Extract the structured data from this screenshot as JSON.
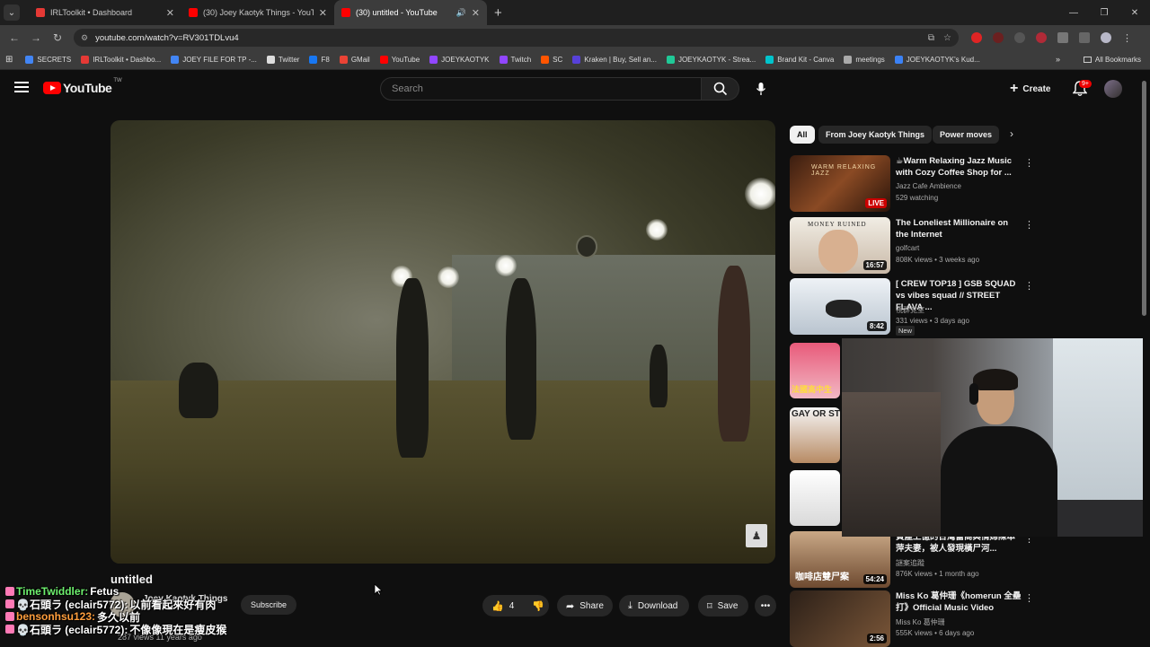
{
  "browser": {
    "tabs": [
      {
        "title": "IRLToolkit • Dashboard",
        "favicon_color": "#e53935"
      },
      {
        "title": "(30) Joey Kaotyk Things - YouTube",
        "favicon_color": "#ff0000"
      },
      {
        "title": "(30) untitled - YouTube",
        "favicon_color": "#ff0000"
      }
    ],
    "url": "youtube.com/watch?v=RV301TDLvu4",
    "bookmarks": [
      {
        "label": "SECRETS",
        "color": "#4285f4"
      },
      {
        "label": "IRLToolkit • Dashbo...",
        "color": "#e53935"
      },
      {
        "label": "JOEY FILE FOR TP -...",
        "color": "#4285f4"
      },
      {
        "label": "Twitter",
        "color": "#dddddd"
      },
      {
        "label": "F8",
        "color": "#1877f2"
      },
      {
        "label": "GMail",
        "color": "#ea4335"
      },
      {
        "label": "YouTube",
        "color": "#ff0000"
      },
      {
        "label": "JOEYKAOTYK",
        "color": "#9146ff"
      },
      {
        "label": "Twitch",
        "color": "#9146ff"
      },
      {
        "label": "SC",
        "color": "#ff5500"
      },
      {
        "label": "Kraken | Buy, Sell an...",
        "color": "#5741d9"
      },
      {
        "label": "JOEYKAOTYK - Strea...",
        "color": "#20c997"
      },
      {
        "label": "Brand Kit - Canva",
        "color": "#00c4cc"
      },
      {
        "label": "meetings",
        "color": "#aaaaaa"
      },
      {
        "label": "JOEYKAOTYK's Kud...",
        "color": "#3b82f6"
      }
    ],
    "all_bookmarks": "All Bookmarks"
  },
  "youtube": {
    "logo_text": "YouTube",
    "logo_region": "TW",
    "search_placeholder": "Search",
    "create_label": "Create",
    "notif_count": "9+"
  },
  "video": {
    "title": "untitled",
    "channel": "Joey Kaotyk Things",
    "subscribe_label": "Subscribe",
    "meta": "287 views  11 years ago",
    "likes": "4",
    "share_label": "Share",
    "download_label": "Download",
    "save_label": "Save"
  },
  "chips": [
    "All",
    "From Joey Kaotyk Things",
    "Power moves"
  ],
  "recommendations": [
    {
      "title": "☕Warm Relaxing Jazz Music with Cozy Coffee Shop for ...",
      "channel": "Jazz Cafe Ambience",
      "stats": "529 watching",
      "badge": "LIVE",
      "thumb_text": "WARM RELAXING JAZZ"
    },
    {
      "title": "The Loneliest Millionaire on the Internet",
      "channel": "golfcart",
      "stats": "808K views • 3 weeks ago",
      "badge": "16:57",
      "thumb_text": "MONEY RUINED"
    },
    {
      "title": "[ CREW TOP18 ] GSB SQUAD vs vibes squad // STREET FLAVA ...",
      "channel": "視群覚室",
      "stats": "331 views • 3 days ago",
      "badge": "8:42",
      "new_label": "New"
    },
    {
      "title": "資產上億的台灣富商與情婦陳萃萍夫妻，被人發現橫尸河...",
      "channel": "謎案追蹤",
      "stats": "876K views • 1 month ago",
      "badge": "54:24",
      "thumb_text": "咖啡店雙尸案"
    },
    {
      "title": "Miss Ko 葛仲珊《homerun 全壘打》Official Music Video",
      "channel": "Miss Ko 葛仲珊",
      "stats": "555K views • 6 days ago",
      "badge": "2:56"
    }
  ],
  "partial_thumbs": [
    "法國高中生",
    "GAY OR ST"
  ],
  "chat": [
    {
      "user": "TimeTwiddler:",
      "msg": " Fetus",
      "color": "#6ef06e",
      "icon_color": "#ff7ab6"
    },
    {
      "user": "💀石頭ラ (eclair5772):",
      "msg": " 以前看起來好有肉",
      "color": "#ffffff",
      "icon_color": "#ff7ab6"
    },
    {
      "user": "bensonhsu123:",
      "msg": " 多久以前",
      "color": "#ff9e3d",
      "icon_color": "#ff7ab6"
    },
    {
      "user": "💀石頭ラ (eclair5772):",
      "msg": " 不像像現在是瘦皮猴",
      "color": "#ffffff",
      "icon_color": "#ff7ab6"
    }
  ]
}
